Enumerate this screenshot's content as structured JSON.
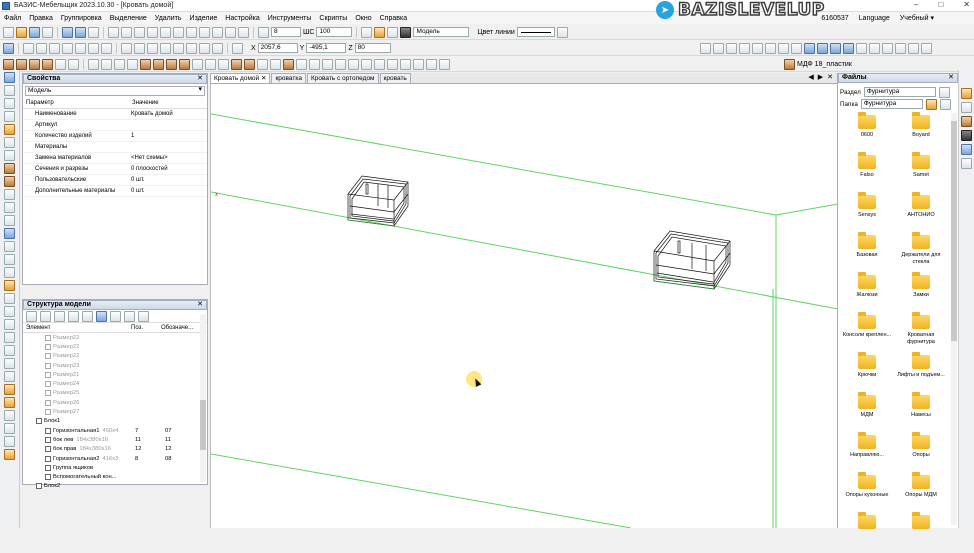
{
  "window": {
    "title": "БАЗИС-Мебельщик 2023.10.30 - [Кровать домой]",
    "controls": [
      "–",
      "□",
      "✕"
    ]
  },
  "brand": {
    "logo_icon": "telegram-icon",
    "text": "BAZISLEVELUP"
  },
  "menu": {
    "items": [
      "Файл",
      "Правка",
      "Группировка",
      "Выделение",
      "Удалить",
      "Изделие",
      "Настройка",
      "Инструменты",
      "Скрипты",
      "Окно",
      "Справка"
    ],
    "right": {
      "code": "6160537",
      "language": "Language",
      "mode": "Учебный ▾"
    }
  },
  "toolbar2": {
    "thickness": "8",
    "step_label": "ШС",
    "step_value": "100",
    "layer": "Модель",
    "line_color_label": "Цвет линии",
    "material": "МДФ 18_пластик"
  },
  "coords": {
    "x_label": "X",
    "x": "2057,6",
    "y_label": "Y",
    "y": "-495,1",
    "z_label": "Z",
    "z": "80"
  },
  "properties": {
    "title": "Свойства",
    "close": "✕",
    "scope": "Модель",
    "col_param": "Параметр",
    "col_value": "Значение",
    "rows": [
      {
        "name": "Наименование",
        "value": "Кровать домой"
      },
      {
        "name": "Артикул",
        "value": ""
      },
      {
        "name": "Количество изделий",
        "value": "1"
      },
      {
        "name": "Материалы",
        "value": ""
      },
      {
        "name": "Замена материалов",
        "value": "<Нет схемы>"
      },
      {
        "name": "Сечения и разрезы",
        "value": "0 плоскостей"
      },
      {
        "name": "Пользовательские",
        "value": "0 шт."
      },
      {
        "name": "Дополнительные материалы",
        "value": "0 шт."
      }
    ]
  },
  "tree": {
    "title": "Структура модели",
    "close": "✕",
    "col_element": "Элемент",
    "col_pos": "Поз.",
    "col_mark": "Обозначе...",
    "rows": [
      {
        "indent": 2,
        "label": "Размер22",
        "gray": true,
        "dim": "",
        "pos": "",
        "mark": ""
      },
      {
        "indent": 2,
        "label": "Размер22",
        "gray": true,
        "dim": "",
        "pos": "",
        "mark": ""
      },
      {
        "indent": 2,
        "label": "Размер22",
        "gray": true,
        "dim": "",
        "pos": "",
        "mark": ""
      },
      {
        "indent": 2,
        "label": "Размер23",
        "gray": true,
        "dim": "",
        "pos": "",
        "mark": ""
      },
      {
        "indent": 2,
        "label": "Размер21",
        "gray": true,
        "dim": "",
        "pos": "",
        "mark": ""
      },
      {
        "indent": 2,
        "label": "Размер24",
        "gray": true,
        "dim": "",
        "pos": "",
        "mark": ""
      },
      {
        "indent": 2,
        "label": "Размер25",
        "gray": true,
        "dim": "",
        "pos": "",
        "mark": ""
      },
      {
        "indent": 2,
        "label": "Размер26",
        "gray": true,
        "dim": "",
        "pos": "",
        "mark": ""
      },
      {
        "indent": 2,
        "label": "Размер27",
        "gray": true,
        "dim": "",
        "pos": "",
        "mark": ""
      },
      {
        "indent": 1,
        "label": "Блок1",
        "gray": false,
        "dim": "",
        "pos": "",
        "mark": ""
      },
      {
        "indent": 2,
        "label": "Горизонтальная1",
        "gray": false,
        "dim": "450x4",
        "pos": "7",
        "mark": "07"
      },
      {
        "indent": 2,
        "label": "бок лев",
        "gray": false,
        "dim": "184x380x16",
        "pos": "11",
        "mark": "11"
      },
      {
        "indent": 2,
        "label": "бок прав",
        "gray": false,
        "dim": "184x380x16",
        "pos": "12",
        "mark": "12"
      },
      {
        "indent": 2,
        "label": "Горизонтальная2",
        "gray": false,
        "dim": "416x3",
        "pos": "8",
        "mark": "08"
      },
      {
        "indent": 2,
        "label": "Группа ящиков",
        "gray": false,
        "dim": "",
        "pos": "",
        "mark": ""
      },
      {
        "indent": 2,
        "label": "Вспомогательный кон...",
        "gray": false,
        "dim": "",
        "pos": "",
        "mark": ""
      },
      {
        "indent": 1,
        "label": "Блок2",
        "gray": false,
        "dim": "",
        "pos": "",
        "mark": ""
      }
    ]
  },
  "doc_tabs": [
    {
      "label": "Кровать домой",
      "active": true
    },
    {
      "label": "кроватка",
      "active": false
    },
    {
      "label": "Кровать с ортопедом",
      "active": false
    },
    {
      "label": "кровать",
      "active": false
    }
  ],
  "doc_nav": [
    "◀",
    "▶",
    "✕"
  ],
  "files": {
    "title": "Файлы",
    "close": "✕",
    "section_label": "Раздел",
    "section_value": "Фурнитура",
    "folder_label": "Папка",
    "folder_value": "Фурнитура",
    "items": [
      "0600",
      "Boyard",
      "Falso",
      "Samet",
      "Sensys",
      "АНТОНИО",
      "Базовая",
      "Держатели для стекла",
      "Жалюзи",
      "Замки",
      "Консоли креплен...",
      "Кроватная фурнитура",
      "Крючки",
      "Лифты и подъем...",
      "МДМ",
      "Навесы",
      "Направляю...",
      "Опоры",
      "Опоры кухонные",
      "Опоры МДМ",
      "",
      ""
    ]
  },
  "viewport": {
    "origin_mark": "x"
  }
}
